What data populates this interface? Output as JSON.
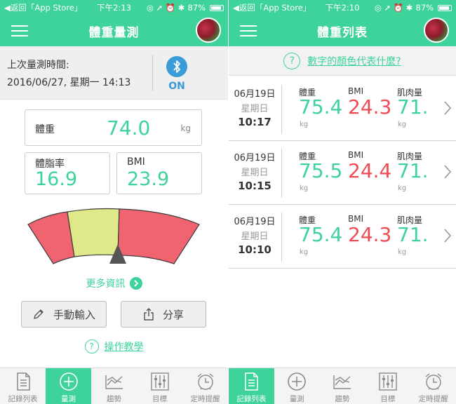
{
  "status_left": {
    "back": "◀返回「App Store」",
    "time": "下午2:13",
    "battery": "87%"
  },
  "status_right": {
    "back": "◀返回「App Store」",
    "time": "下午2:10",
    "battery": "87%"
  },
  "left": {
    "title": "體重量測",
    "last_label": "上次量測時間:",
    "last_datetime": "2016/06/27, 星期一 14:13",
    "bluetooth_state": "ON",
    "weight_label": "體重",
    "weight_value": "74.0",
    "weight_unit": "kg",
    "fat_label": "體脂率",
    "fat_value": "16.9",
    "bmi_label": "BMI",
    "bmi_value": "23.9",
    "more_info": "更多資訊",
    "manual_input": "手動輸入",
    "share": "分享",
    "tutorial": "操作教學",
    "colors": {
      "accent": "#3dd39a",
      "red": "#f06472",
      "yellow": "#dfe98a",
      "bluetooth": "#3a9bd9"
    }
  },
  "right": {
    "title": "體重列表",
    "color_help": "數字的顏色代表什麼?",
    "col_labels": {
      "weight": "體重",
      "bmi": "BMI",
      "muscle": "肌肉量"
    },
    "unit": "kg",
    "records": [
      {
        "date": "06月19日",
        "weekday": "星期日",
        "time": "10:17",
        "weight": "75.4",
        "bmi": "24.3",
        "muscle": "71."
      },
      {
        "date": "06月19日",
        "weekday": "星期日",
        "time": "10:15",
        "weight": "75.5",
        "bmi": "24.4",
        "muscle": "71."
      },
      {
        "date": "06月19日",
        "weekday": "星期日",
        "time": "10:10",
        "weight": "75.4",
        "bmi": "24.3",
        "muscle": "71."
      }
    ]
  },
  "tabs": {
    "records": "記錄列表",
    "measure": "量測",
    "trend": "趨勢",
    "goal": "目標",
    "reminder": "定時提醒"
  },
  "icons": [
    "menu-icon",
    "avatar",
    "bluetooth-icon",
    "chevron-right-icon",
    "pencil-icon",
    "share-icon",
    "question-icon",
    "list-icon",
    "plus-circle-icon",
    "trend-icon",
    "sliders-icon",
    "alarm-clock-icon"
  ]
}
